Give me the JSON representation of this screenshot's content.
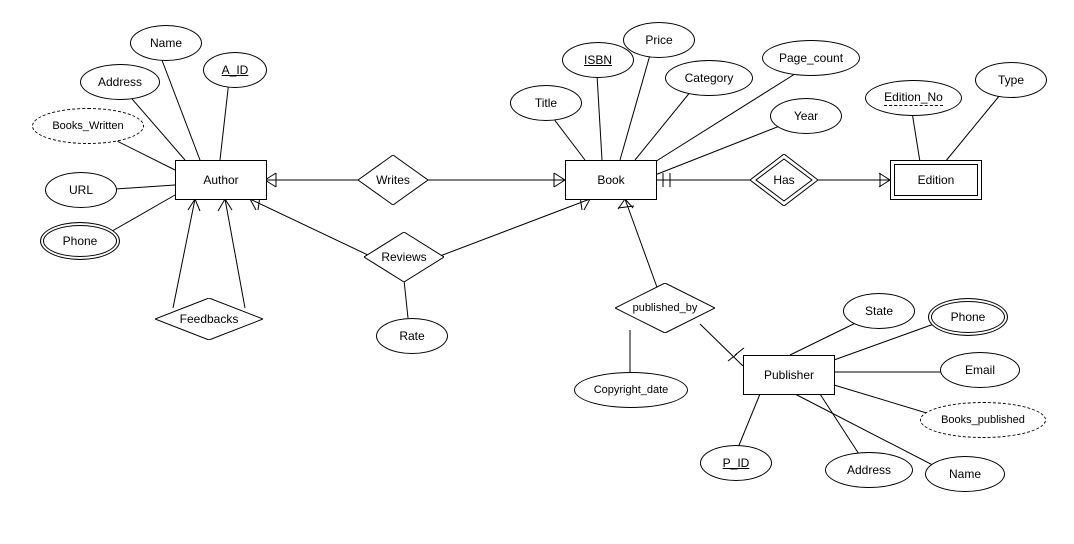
{
  "entities": {
    "author": "Author",
    "book": "Book",
    "edition": "Edition",
    "publisher": "Publisher"
  },
  "relationships": {
    "writes": "Writes",
    "reviews": "Reviews",
    "feedbacks": "Feedbacks",
    "has": "Has",
    "published_by": "published_by"
  },
  "attributes": {
    "author": {
      "name": "Name",
      "address": "Address",
      "a_id": "A_ID",
      "books_written": "Books_Written",
      "url": "URL",
      "phone": "Phone"
    },
    "book": {
      "isbn": "ISBN",
      "price": "Price",
      "title": "Title",
      "category": "Category",
      "page_count": "Page_count",
      "year": "Year"
    },
    "edition": {
      "edition_no": "Edition_No",
      "type": "Type"
    },
    "reviews": {
      "rate": "Rate"
    },
    "published_by": {
      "copyright_date": "Copyright_date"
    },
    "publisher": {
      "p_id": "P_ID",
      "address": "Address",
      "name": "Name",
      "books_published": "Books_published",
      "email": "Email",
      "phone": "Phone",
      "state": "State"
    }
  },
  "chart_data": {
    "type": "er-diagram",
    "entities": [
      {
        "id": "Author",
        "type": "strong",
        "attributes": [
          {
            "name": "A_ID",
            "key": true
          },
          {
            "name": "Name"
          },
          {
            "name": "Address"
          },
          {
            "name": "Books_Written",
            "derived": true
          },
          {
            "name": "URL"
          },
          {
            "name": "Phone",
            "multivalued": true
          }
        ]
      },
      {
        "id": "Book",
        "type": "strong",
        "attributes": [
          {
            "name": "ISBN",
            "key": true
          },
          {
            "name": "Title"
          },
          {
            "name": "Price"
          },
          {
            "name": "Category"
          },
          {
            "name": "Page_count"
          },
          {
            "name": "Year"
          }
        ]
      },
      {
        "id": "Edition",
        "type": "weak",
        "attributes": [
          {
            "name": "Edition_No",
            "partial_key": true
          },
          {
            "name": "Type"
          }
        ]
      },
      {
        "id": "Publisher",
        "type": "strong",
        "attributes": [
          {
            "name": "P_ID",
            "key": true
          },
          {
            "name": "Name"
          },
          {
            "name": "Address"
          },
          {
            "name": "Books_published",
            "derived": true
          },
          {
            "name": "Email"
          },
          {
            "name": "Phone",
            "multivalued": true
          },
          {
            "name": "State"
          }
        ]
      }
    ],
    "relationships": [
      {
        "id": "Writes",
        "between": [
          "Author",
          "Book"
        ],
        "cardinality": "M:N"
      },
      {
        "id": "Reviews",
        "between": [
          "Author",
          "Book"
        ],
        "cardinality": "M:N",
        "attributes": [
          {
            "name": "Rate"
          }
        ]
      },
      {
        "id": "Feedbacks",
        "between": [
          "Author",
          "Author"
        ],
        "recursive": true
      },
      {
        "id": "Has",
        "between": [
          "Book",
          "Edition"
        ],
        "identifying": true,
        "cardinality": "1:N"
      },
      {
        "id": "published_by",
        "between": [
          "Book",
          "Publisher"
        ],
        "cardinality": "N:1",
        "attributes": [
          {
            "name": "Copyright_date"
          }
        ]
      }
    ]
  }
}
